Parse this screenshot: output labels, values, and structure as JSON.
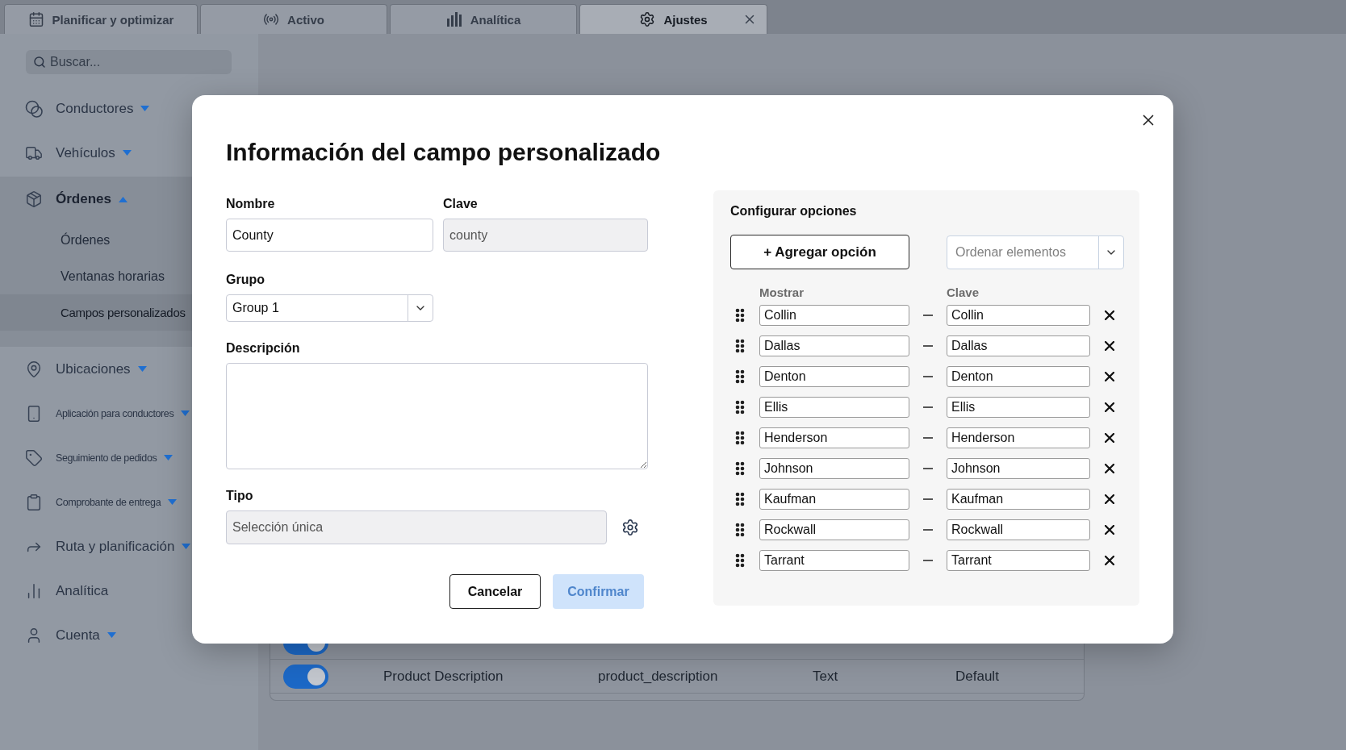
{
  "tabs": [
    {
      "label": "Planificar y optimizar",
      "selected": false,
      "closable": false
    },
    {
      "label": "Activo",
      "selected": false,
      "closable": false
    },
    {
      "label": "Analítica",
      "selected": false,
      "closable": false
    },
    {
      "label": "Ajustes",
      "selected": true,
      "closable": true
    }
  ],
  "sidebar": {
    "search": {
      "placeholder": "Buscar..."
    },
    "items": [
      {
        "label": "Conductores",
        "kind": "menu",
        "expanded": false,
        "selected": false
      },
      {
        "label": "Vehículos",
        "kind": "menu",
        "expanded": false,
        "selected": false
      },
      {
        "label": "Órdenes",
        "kind": "menu",
        "expanded": true,
        "selected": true,
        "children": [
          {
            "label": "Órdenes",
            "selected": false
          },
          {
            "label": "Ventanas horarias",
            "selected": false
          },
          {
            "label": "Campos personalizados",
            "selected": true
          }
        ]
      },
      {
        "label": "Ubicaciones",
        "kind": "menu",
        "expanded": false,
        "selected": false
      },
      {
        "label": "Aplicación para conductores",
        "kind": "menu",
        "expanded": false,
        "selected": false
      },
      {
        "label": "Seguimiento de pedidos",
        "kind": "menu",
        "expanded": false,
        "selected": false
      },
      {
        "label": "Comprobante de entrega",
        "kind": "menu",
        "expanded": false,
        "selected": false
      },
      {
        "label": "Ruta y planificación",
        "kind": "menu",
        "expanded": false,
        "selected": false
      },
      {
        "label": "Analítica",
        "kind": "link",
        "selected": false
      },
      {
        "label": "Cuenta",
        "kind": "menu",
        "expanded": false,
        "selected": false
      }
    ]
  },
  "table": {
    "rows": [
      {
        "on": true
      },
      {
        "on": true,
        "cells": [
          "Product Description",
          "product_description",
          "Text",
          "Default"
        ]
      }
    ]
  },
  "modal": {
    "title": "Información del campo personalizado",
    "fields": {
      "name": {
        "label": "Nombre",
        "value": "County",
        "disabled": false
      },
      "key": {
        "label": "Clave",
        "value": "county",
        "disabled": true
      },
      "group": {
        "label": "Grupo",
        "value": "Group 1"
      },
      "description": {
        "label": "Descripción"
      },
      "type": {
        "label": "Tipo",
        "value": "Selección única",
        "disabled": true
      }
    },
    "buttons": [
      {
        "label": "Cancelar",
        "kind": "secondary",
        "disabled": false
      },
      {
        "label": "Confirmar",
        "kind": "primary",
        "disabled": true
      }
    ],
    "options": {
      "title": "Configurar opciones",
      "add_button": "+ Agregar opción",
      "sort": {
        "placeholder": "Ordenar elementos"
      },
      "columns": [
        "Mostrar",
        "Clave"
      ],
      "rows": [
        {
          "display": "Collin",
          "key": "Collin"
        },
        {
          "display": "Dallas",
          "key": "Dallas"
        },
        {
          "display": "Denton",
          "key": "Denton"
        },
        {
          "display": "Ellis",
          "key": "Ellis"
        },
        {
          "display": "Henderson",
          "key": "Henderson"
        },
        {
          "display": "Johnson",
          "key": "Johnson"
        },
        {
          "display": "Kaufman",
          "key": "Kaufman"
        },
        {
          "display": "Rockwall",
          "key": "Rockwall"
        },
        {
          "display": "Tarrant",
          "key": "Tarrant"
        }
      ]
    }
  }
}
